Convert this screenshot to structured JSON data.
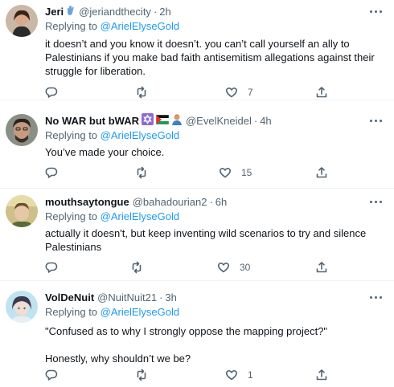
{
  "tweets": [
    {
      "name": "Jeri",
      "name_emoji": "hand-blue",
      "handle": "@jeriandthecity",
      "time": "2h",
      "replying_to_label": "Replying to ",
      "replying_to_user": "@ArielElyseGold",
      "text": "it doesn’t and you know it doesn’t. you can’t call yourself an ally to Palestinians if you make bad faith antisemitism allegations against their struggle for liberation.",
      "replies": "",
      "retweets": "",
      "likes": "7"
    },
    {
      "name": "No WAR but bWAR",
      "name_emoji": "star-of-david, palestine-flag, person",
      "handle": "@EvelKneidel",
      "time": "4h",
      "replying_to_label": "Replying to ",
      "replying_to_user": "@ArielElyseGold",
      "text": "You’ve made your choice.",
      "replies": "",
      "retweets": "",
      "likes": "15"
    },
    {
      "name": "mouthsaytongue",
      "handle": "@bahadourian2",
      "time": "6h",
      "replying_to_label": "Replying to ",
      "replying_to_user": "@ArielElyseGold",
      "text": "actually it doesn't, but keep inventing wild scenarios to try and silence Palestinians",
      "replies": "",
      "retweets": "",
      "likes": "30"
    },
    {
      "name": "VolDeNuit",
      "handle": "@NuitNuit21",
      "time": "3h",
      "replying_to_label": "Replying to ",
      "replying_to_user": "@ArielElyseGold",
      "text": "\"Confused as to why I strongly oppose the mapping project?\"\n\nHonestly, why shouldn’t we be?",
      "replies": "",
      "retweets": "",
      "likes": "1"
    }
  ],
  "icons": [
    "more-icon",
    "reply-icon",
    "retweet-icon",
    "like-icon",
    "share-icon"
  ],
  "colors": {
    "text": "#0f1419",
    "secondary": "#536471",
    "link": "#1d9bf0",
    "divider": "#eff3f4"
  }
}
